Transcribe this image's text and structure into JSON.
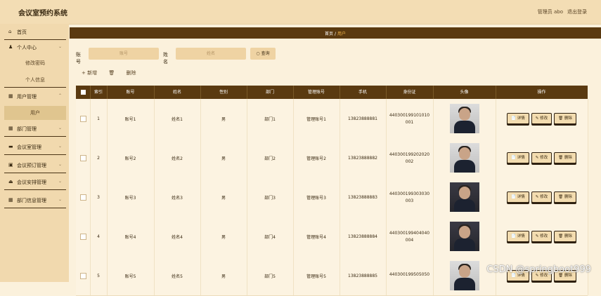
{
  "app": {
    "title": "会议室预约系统",
    "admin_label": "管理员 abo",
    "logout": "退出登录"
  },
  "sidebar": {
    "home": "首页",
    "personal": "个人中心",
    "personal_sub": [
      "修改密码",
      "个人信息"
    ],
    "user_mgmt": "用户管理",
    "user_sub": "用户",
    "dept_mgmt": "部门管理",
    "room_mgmt": "会议室管理",
    "booking_mgmt": "会议预订管理",
    "arrange_mgmt": "会议安排管理",
    "dept_info_mgmt": "部门信息管理"
  },
  "breadcrumb": {
    "home": "首页",
    "sep": "/",
    "current": "用户"
  },
  "search": {
    "account_label": "账号",
    "account_placeholder": "账号",
    "name_label": "姓名",
    "name_placeholder": "姓名",
    "button": "查询"
  },
  "actions": {
    "add": "+ 新增",
    "delete": "删除"
  },
  "table": {
    "headers": [
      "索引",
      "账号",
      "姓名",
      "性别",
      "部门",
      "管理账号",
      "手机",
      "身份证",
      "头像",
      "操作"
    ],
    "rows": [
      {
        "index": "1",
        "account": "账号1",
        "name": "姓名1",
        "gender": "男",
        "dept": "部门1",
        "admin": "管理账号1",
        "phone": "13823888881",
        "id_line1": "440300199101010",
        "id_line2": "001"
      },
      {
        "index": "2",
        "account": "账号2",
        "name": "姓名2",
        "gender": "男",
        "dept": "部门2",
        "admin": "管理账号2",
        "phone": "13823888882",
        "id_line1": "440300199202020",
        "id_line2": "002"
      },
      {
        "index": "3",
        "account": "账号3",
        "name": "姓名3",
        "gender": "男",
        "dept": "部门3",
        "admin": "管理账号3",
        "phone": "13823888883",
        "id_line1": "440300199303030",
        "id_line2": "003"
      },
      {
        "index": "4",
        "account": "账号4",
        "name": "姓名4",
        "gender": "男",
        "dept": "部门4",
        "admin": "管理账号4",
        "phone": "13823888884",
        "id_line1": "440300199404040",
        "id_line2": "004"
      },
      {
        "index": "5",
        "account": "账号5",
        "name": "姓名5",
        "gender": "男",
        "dept": "部门5",
        "admin": "管理账号5",
        "phone": "13823888885",
        "id_line1": "440300199505050",
        "id_line2": ""
      }
    ],
    "op_detail": "详情",
    "op_edit": "修改",
    "op_delete": "删除"
  },
  "watermark": "CSDN @springboot999",
  "colors": {
    "header_bg": "#5a3a10",
    "sidebar_bg": "#f1d9ae",
    "page_bg": "#fbf1dc",
    "accent": "#f3b64a"
  }
}
